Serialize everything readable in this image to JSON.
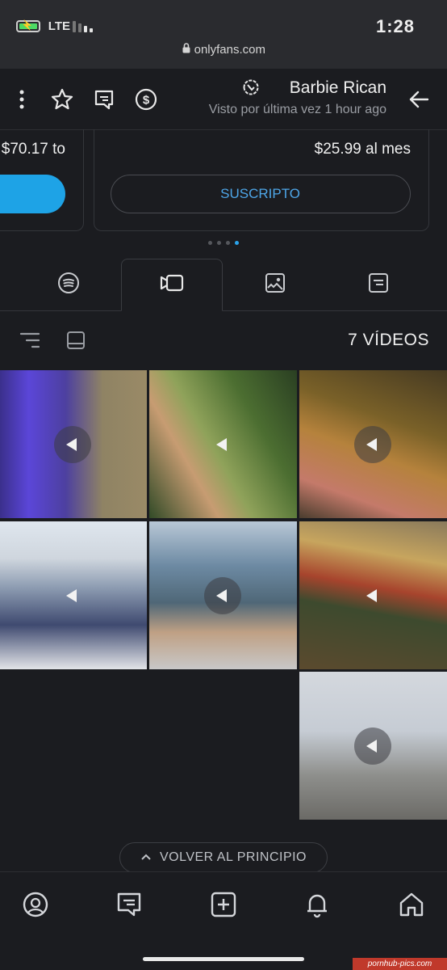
{
  "status_bar": {
    "time": "1:28",
    "network": "LTE",
    "url": "onlyfans.com"
  },
  "header": {
    "name": "Barbie Rican",
    "last_seen": "Visto por última vez 1 hour ago"
  },
  "subscription": {
    "price_1": "$25.99 al mes",
    "button_1": "SUSCRIPTO",
    "price_2": "$70.17 to",
    "carousel_pages": 4,
    "carousel_active": 4
  },
  "tabs": [
    "posts",
    "photos",
    "videos",
    "music"
  ],
  "active_tab": "videos",
  "media": {
    "count_label": "7 VÍDEOS"
  },
  "back_to_top": "VOLVER AL PRINCIPIO",
  "bottom_nav": [
    "home",
    "notifications",
    "add",
    "messages",
    "profile"
  ],
  "watermark": "pornhub-pics.com",
  "colors": {
    "accent": "#2ba3ea",
    "background": "#1b1c20",
    "status_bar": "#2a2b2f"
  }
}
